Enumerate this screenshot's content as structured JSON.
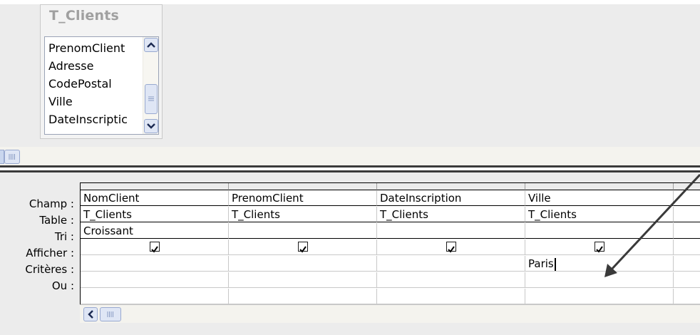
{
  "table_window": {
    "title": "T_Clients",
    "fields": [
      "PrenomClient",
      "Adresse",
      "CodePostal",
      "Ville",
      "DateInscriptic"
    ]
  },
  "grid": {
    "row_labels": [
      "Champ :",
      "Table :",
      "Tri :",
      "Afficher :",
      "Critères :",
      "Ou :"
    ],
    "columns": [
      {
        "champ": "NomClient",
        "table": "T_Clients",
        "tri": "Croissant",
        "afficher": true,
        "criteres": "",
        "ou": ""
      },
      {
        "champ": "PrenomClient",
        "table": "T_Clients",
        "tri": "",
        "afficher": true,
        "criteres": "",
        "ou": ""
      },
      {
        "champ": "DateInscription",
        "table": "T_Clients",
        "tri": "",
        "afficher": true,
        "criteres": "",
        "ou": ""
      },
      {
        "champ": "Ville",
        "table": "T_Clients",
        "tri": "",
        "afficher": true,
        "criteres": "Paris",
        "ou": ""
      }
    ]
  },
  "icons": {
    "scroll_up": "chevron-up-icon",
    "scroll_down": "chevron-down-icon",
    "scroll_left": "chevron-left-icon",
    "thumb_grip": "grip-icon",
    "annotation": "arrow-icon"
  },
  "colors": {
    "pane_background": "#ececec",
    "scrollbar_button": "#dfe6f5",
    "scrollbar_border": "#98a9d0",
    "annotation_arrow": "#3a3a3a"
  }
}
